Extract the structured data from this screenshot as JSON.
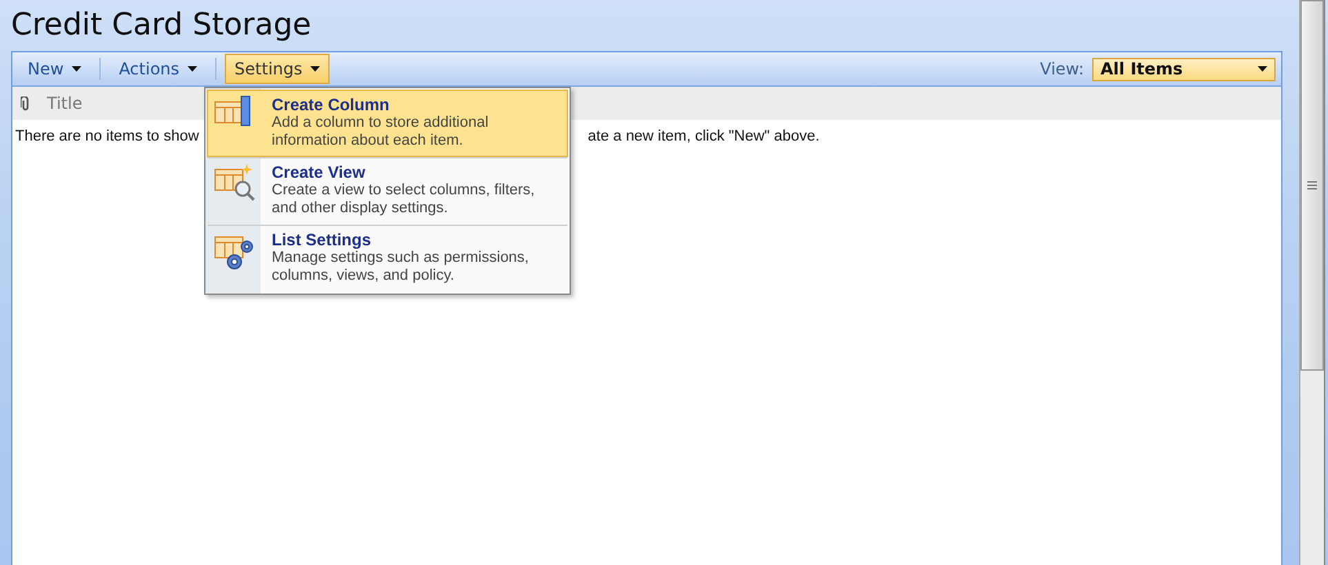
{
  "page_title": "Credit Card Storage",
  "toolbar": {
    "menus": [
      {
        "label": "New",
        "selected": false
      },
      {
        "label": "Actions",
        "selected": false
      },
      {
        "label": "Settings",
        "selected": true
      }
    ],
    "view_label": "View:",
    "view_value": "All Items"
  },
  "columns": [
    "Title"
  ],
  "empty_message": {
    "before_menu": "There are no items to show",
    "after_menu": "ate a new item, click \"New\" above."
  },
  "settings_menu": [
    {
      "kind": "column",
      "title": "Create Column",
      "description": "Add a column to store additional information about each item.",
      "selected": true
    },
    {
      "kind": "view",
      "title": "Create View",
      "description": "Create a view to select columns, filters, and other display settings.",
      "selected": false
    },
    {
      "kind": "settings",
      "title": "List Settings",
      "description": "Manage settings such as permissions, columns, views, and policy.",
      "selected": false
    }
  ]
}
